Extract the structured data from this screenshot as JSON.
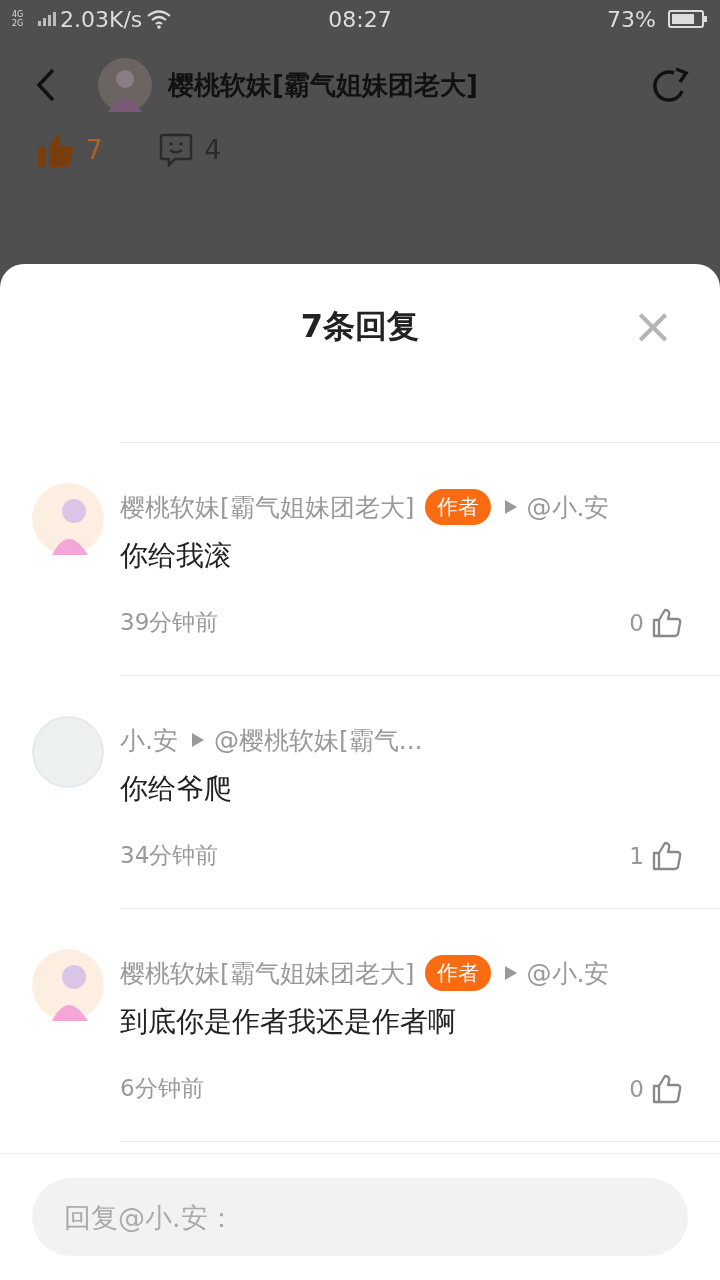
{
  "status_bar": {
    "network": "4G 2G",
    "speed": "2.03K/s",
    "time": "08:27",
    "battery": "73%"
  },
  "header": {
    "title": "樱桃软妹[霸气姐妹团老大]",
    "likes": "7",
    "comments": "4"
  },
  "sheet": {
    "title": "7条回复",
    "close": "×"
  },
  "comments": [
    {
      "avatar_image": true,
      "name": "樱桃软妹[霸气姐妹团老大]",
      "badge": "作者",
      "reply_to": "@小.安",
      "text": "你给我滚",
      "time": "39分钟前",
      "likes": "0"
    },
    {
      "avatar_image": false,
      "name": "小.安",
      "reply_to": "@樱桃软妹[霸气...",
      "text": "你给爷爬",
      "time": "34分钟前",
      "likes": "1"
    },
    {
      "avatar_image": true,
      "name": "樱桃软妹[霸气姐妹团老大]",
      "badge": "作者",
      "reply_to": "@小.安",
      "text": "到底你是作者我还是作者啊",
      "time": "6分钟前",
      "likes": "0"
    }
  ],
  "reply_field": {
    "placeholder": "回复@小.安："
  }
}
